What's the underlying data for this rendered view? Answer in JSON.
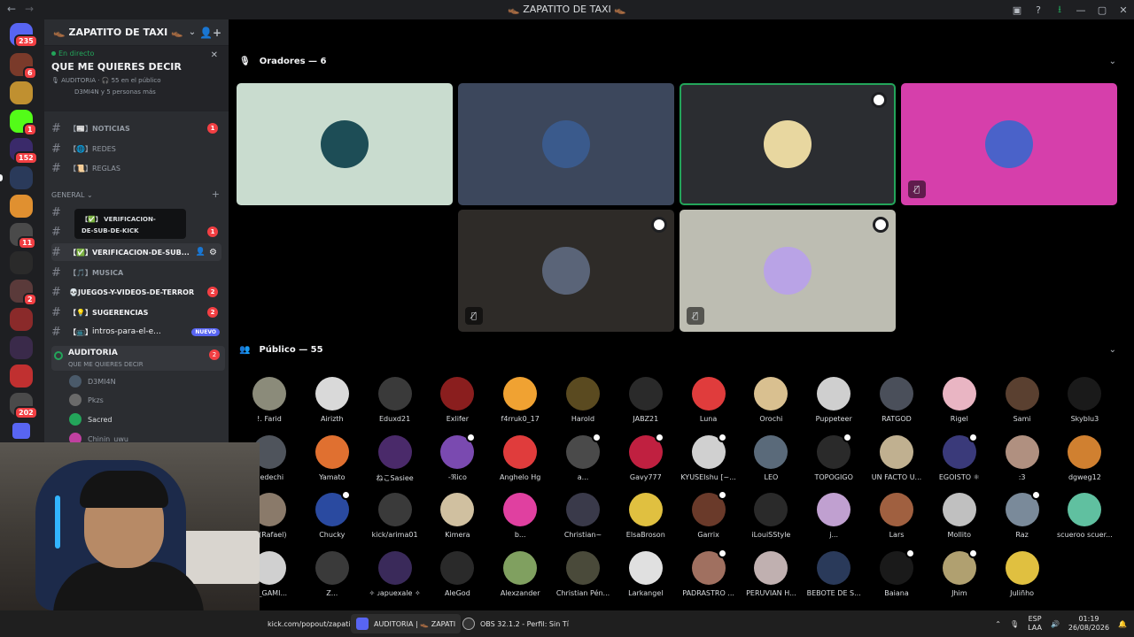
{
  "window": {
    "title": "👞 ZAPATITO DE TAXI 👞",
    "back": "←",
    "forward": "→"
  },
  "titlebar_icons": [
    "inbox-icon",
    "help-icon",
    "download-icon",
    "minimize-icon",
    "maximize-icon",
    "close-icon"
  ],
  "titlebar_glyphs": {
    "inbox": "▣",
    "help": "?",
    "download": "⭳",
    "minimize": "—",
    "maximize": "▢",
    "close": "✕"
  },
  "servers": {
    "dm_badge": "235",
    "badges": [
      "6",
      "1",
      "152",
      "11",
      "2",
      "202"
    ]
  },
  "guild": {
    "name": "👞 ZAPATITO DE TAXI 👞",
    "chevron": "⌄",
    "add_user": "👤+"
  },
  "stage": {
    "live_label": "En directo",
    "title": "QUE ME QUIERES DECIR",
    "info": "🎙 AUDITORIA · 🎧 55 en el público",
    "speakers": "D3MI4N y 5 personas más",
    "close": "✕"
  },
  "channels": [
    {
      "icon": "【📰】",
      "name": "noticias",
      "badge": "1"
    },
    {
      "icon": "【🌐】",
      "name": "redes",
      "badge": ""
    },
    {
      "icon": "【📜】",
      "name": "reglas",
      "badge": ""
    }
  ],
  "category": {
    "name": "GENERAL",
    "add": "+"
  },
  "tooltip": {
    "line1": "【✅】 VERIFICACION-",
    "line2": "DE-SUB-DE-KICK"
  },
  "general_channels": [
    {
      "icon": "",
      "name": "",
      "badge": ""
    },
    {
      "icon": "",
      "name": "",
      "badge": "1"
    },
    {
      "icon": "【✅】",
      "name": "verificacion-de-sub...",
      "badge": ""
    },
    {
      "icon": "【🎵】",
      "name": "musica",
      "badge": ""
    },
    {
      "icon": "💀",
      "name": "juegos-y-videos-de-terror",
      "badge": "2"
    },
    {
      "icon": "【💡】",
      "name": "sugerencias",
      "badge": "2"
    },
    {
      "icon": "【📺】",
      "name": "intros-para-el-e...",
      "badge": ""
    }
  ],
  "nuevo": "NUEVO",
  "auditoria": {
    "name": "AUDITORIA",
    "sub": "QUE ME QUIERES DECIR",
    "badge": "2"
  },
  "members": [
    "D3MI4N",
    "Pkzs",
    "Sacred",
    "Chinin_uwu"
  ],
  "speakers_header": {
    "label": "Oradores — 6",
    "chevron": "⌄"
  },
  "audience_header": {
    "label": "Público — 55",
    "chevron": "⌄"
  },
  "speaker_tiles": [
    {
      "bg": "#c9dccf",
      "av": "#1d4d56",
      "mod": false,
      "muted": false
    },
    {
      "bg": "#3c475c",
      "av": "#3a5a8c",
      "mod": false,
      "muted": false
    },
    {
      "bg": "#2b2d31",
      "av": "#e8d7a0",
      "mod": true,
      "muted": false
    },
    {
      "bg": "#d63fab",
      "av": "#4a62c9",
      "mod": false,
      "muted": true
    },
    {
      "bg": "#2e2b28",
      "av": "#5a6478",
      "mod": true,
      "muted": true
    },
    {
      "bg": "#bdbdb2",
      "av": "#b9a3e6",
      "mod": true,
      "muted": true
    }
  ],
  "mute_icon": "🎙̸",
  "audience": [
    {
      "n": "!. Farid",
      "c": "#8b8b7a"
    },
    {
      "n": "Airizth",
      "c": "#d9d9d9"
    },
    {
      "n": "Eduxd21",
      "c": "#3a3a3a"
    },
    {
      "n": "Exlifer",
      "c": "#8a1e1e"
    },
    {
      "n": "f4rruk0_17",
      "c": "#f0a232"
    },
    {
      "n": "Harold",
      "c": "#5a4a20"
    },
    {
      "n": "JABZ21",
      "c": "#2a2a2a"
    },
    {
      "n": "Luna",
      "c": "#e03c3c"
    },
    {
      "n": "Orochi",
      "c": "#d9c090"
    },
    {
      "n": "Puppeteer",
      "c": "#cfcfcf"
    },
    {
      "n": "RATGOD",
      "c": "#4a4f5a"
    },
    {
      "n": "Rigel",
      "c": "#e9b5c3"
    },
    {
      "n": "Sami",
      "c": "#5a4030"
    },
    {
      "n": "Skyblu3",
      "c": "#1a1a1a"
    },
    {
      "n": "riedechi",
      "c": "#4f545c"
    },
    {
      "n": "Yamato",
      "c": "#e07030"
    },
    {
      "n": "ねこSasiee",
      "c": "#4a2a6a"
    },
    {
      "n": "-ℜico",
      "c": "#7a4ab0"
    },
    {
      "n": "Anghelo Hg",
      "c": "#e03c3c"
    },
    {
      "n": "a...",
      "c": "#4a4a4a"
    },
    {
      "n": "Gavy777",
      "c": "#c02040"
    },
    {
      "n": "KYUSEIshu [~...",
      "c": "#d0d0d0"
    },
    {
      "n": "LEO",
      "c": "#5a6a7a"
    },
    {
      "n": "TOPOGIGO",
      "c": "#2a2a2a"
    },
    {
      "n": "UN FACTO U...",
      "c": "#c0b090"
    },
    {
      "n": "EGOISTO ⚛",
      "c": "#3a3a7a"
    },
    {
      "n": ":3",
      "c": "#b09080"
    },
    {
      "n": "dgweg12",
      "c": "#d08030"
    },
    {
      "n": "d (Rafael)",
      "c": "#8a7a6a"
    },
    {
      "n": "Chucky",
      "c": "#2a4aa0"
    },
    {
      "n": "kick/arima01",
      "c": "#3a3a3a"
    },
    {
      "n": "Kimera",
      "c": "#d0c0a0"
    },
    {
      "n": "b...",
      "c": "#e040a0"
    },
    {
      "n": "Christian~",
      "c": "#3a3a4a"
    },
    {
      "n": "ElsaBroson",
      "c": "#e0c040"
    },
    {
      "n": "Garrix",
      "c": "#6a3a2a"
    },
    {
      "n": "iLouiSStyle",
      "c": "#2a2a2a"
    },
    {
      "n": "j...",
      "c": "#c0a0d0"
    },
    {
      "n": "Lars",
      "c": "#a06040"
    },
    {
      "n": "Mollito",
      "c": "#c0c0c0"
    },
    {
      "n": "Raz",
      "c": "#7a8a9a"
    },
    {
      "n": "scueroo scuer...",
      "c": "#60c0a0"
    },
    {
      "n": "KI_GAMI...",
      "c": "#d0d0d0"
    },
    {
      "n": "Z...",
      "c": "#3a3a3a"
    },
    {
      "n": "✧ּ ᴊapuexale ✧",
      "c": "#3a2a5a"
    },
    {
      "n": "AleGod",
      "c": "#2a2a2a"
    },
    {
      "n": "Alexzander",
      "c": "#80a060"
    },
    {
      "n": "Christian Pén...",
      "c": "#4a4a3a"
    },
    {
      "n": "Larkangel",
      "c": "#e0e0e0"
    },
    {
      "n": "PADRASTRO ...",
      "c": "#a07060"
    },
    {
      "n": "PERUVIAN H...",
      "c": "#c0b0b0"
    },
    {
      "n": "BEBOTE DE S...",
      "c": "#2a3a5a"
    },
    {
      "n": "Baiana",
      "c": "#1a1a1a"
    },
    {
      "n": "Jhim",
      "c": "#b0a070"
    },
    {
      "n": "Juliñho",
      "c": "#e0c040"
    }
  ],
  "taskbar": {
    "items": [
      "kick.com/popout/zapati",
      "AUDITORIA | 👞 ZAPATI",
      "OBS 32.1.2 - Perfil: Sin Tí"
    ],
    "lang": [
      "ESP",
      "LAA"
    ],
    "time": "01:19",
    "date": "26/08/2026",
    "tray_glyphs": [
      "⌃",
      "🎙",
      "🔊"
    ]
  }
}
